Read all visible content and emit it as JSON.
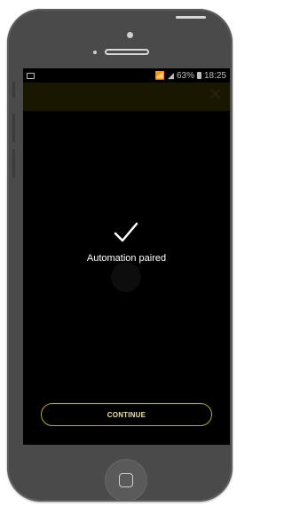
{
  "status_bar": {
    "battery": "63%",
    "time": "18:25"
  },
  "header": {
    "close_icon": "close-icon"
  },
  "main": {
    "check_icon": "check-icon",
    "message": "Automation paired"
  },
  "footer": {
    "continue_label": "CONTINUE"
  },
  "colors": {
    "accent_border": "#b3a83a",
    "screen_bg": "#000000",
    "phone_body": "#4a4a4a"
  }
}
